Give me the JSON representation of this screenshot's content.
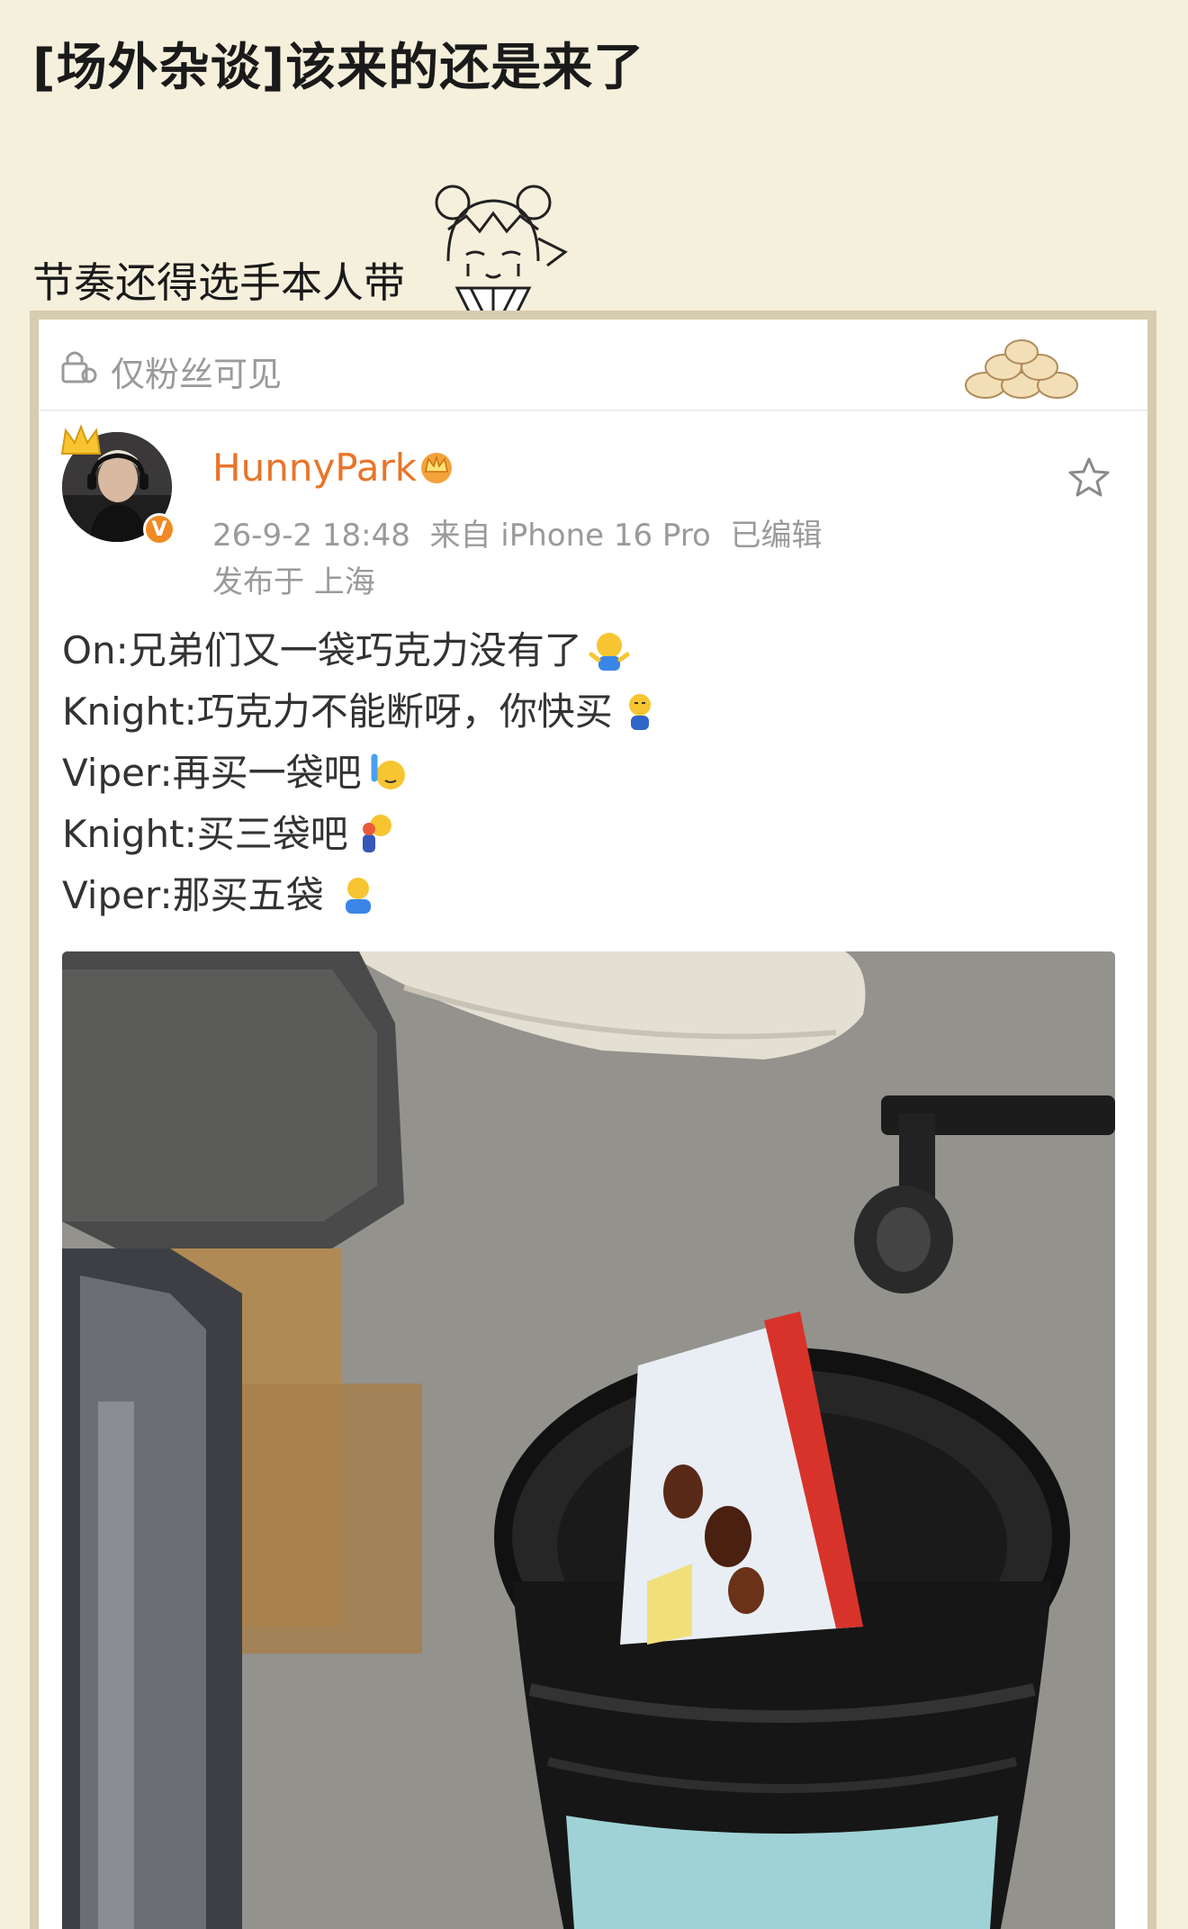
{
  "page": {
    "title": "[场外杂谈]该来的还是来了",
    "caption": "节奏还得选手本人带"
  },
  "card": {
    "visibility_label": "仅粉丝可见",
    "post": {
      "username": "HunnyPark",
      "verified_mark": "V",
      "meta": "26-9-2 18:48  来自 iPhone 16 Pro  已编辑",
      "location": "发布于 上海",
      "lines": [
        "On:兄弟们又一袋巧克力没有了",
        "Knight:巧克力不能断呀，你快买",
        "Viper:再买一袋吧",
        "Knight:买三袋吧",
        "Viper:那买五袋"
      ]
    }
  },
  "icons": {
    "lock": "lock-icon",
    "star": "star-icon",
    "crown": "crown-icon",
    "vip": "vip-crown-icon",
    "sticker": "anime-sticker-icon"
  },
  "colors": {
    "background": "#f5f0dc",
    "username": "#e8752a",
    "verified": "#f08a24",
    "meta": "#9a9a9a"
  }
}
